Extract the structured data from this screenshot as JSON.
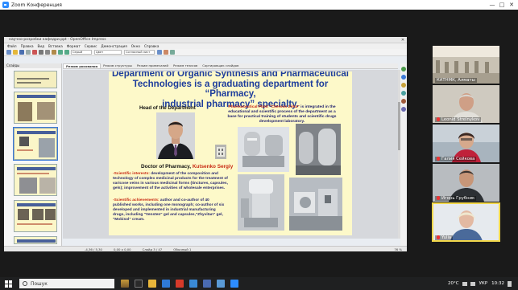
{
  "zoom": {
    "title": "Zoom Конференция",
    "minimize": "—",
    "maximize": "□",
    "close": "✕"
  },
  "impress": {
    "window_title": "научно-розробки кафедри.ppt - OpenOffice Impress",
    "close": "✕",
    "menu": [
      "Файл",
      "Правка",
      "Вид",
      "Вставка",
      "Формат",
      "Сервис",
      "Демонстрация",
      "Окно",
      "Справка"
    ],
    "toolbar": {
      "line_color": "Серый",
      "area": "Цвет",
      "line_value": "Согласный лист"
    },
    "slides_panel_title": "Слайды",
    "slide_numbers": [
      "",
      "",
      "",
      "",
      "",
      ""
    ],
    "tabs": [
      "Режим рисования",
      "Режим структуры",
      "Режим примечаний",
      "Режим тезисов",
      "Сортировщик слайдов"
    ],
    "status": [
      "-4,36 / 5,30",
      "0,00 x 0,00",
      "Слайд 3 / 47",
      "Обычный 1"
    ],
    "zoom_level": "76 %"
  },
  "slide": {
    "title_line1": "Department of Organic Synthesis and Pharmaceutical",
    "title_line2a": "Technologies",
    "title_line2b": " is a graduating department for “Pharmacy,",
    "title_line3": "industrial pharmacy” specialty.",
    "head_label": "Head of the Department",
    "doctor_prefix": "Doctor of Pharmacy, ",
    "doctor_name": "Kutsenko Sergiy",
    "plant_name": "Pharmaceutical Plant \"Chervon Zirka\"",
    "plant_text": " is integrated in the educational and scientific process of the department as a base for practical training of students and scientific drugs development laboratory.",
    "interests_label": "-Scientific interests:",
    "interests_text": " development of the composition and technology of complex medicinal products for the treatment of varicose veins in various medicinal forms (tinctures, capsules, gels); improvement of the activities of wholesale enterprises.",
    "achievements_label": "-Scientific achievements:",
    "achievements_text": " author and co-author of 40 published works, including one monograph; co-author of six developed and implemented in industrial manufacturing drugs, including \"Vensten\" gel and capsules,\"Zhyvitan\" gel, \"Mobisol\" cream."
  },
  "participants": [
    {
      "name": "КАТНМК, Алматы",
      "muted": false
    },
    {
      "name": "Leonid Strelnykov",
      "muted": true
    },
    {
      "name": "Галия Сейкова",
      "muted": true
    },
    {
      "name": "Игорь Грубник",
      "muted": true
    },
    {
      "name": "Yulia",
      "muted": true
    }
  ],
  "taskbar": {
    "search_placeholder": "Пошук",
    "temperature": "20°C",
    "language": "УКР",
    "clock": "10:32"
  },
  "colors": {
    "slide_bg": "#fdf9c9",
    "title_blue": "#1d3d9c",
    "accent_red": "#c82a13",
    "active_speaker": "#f2d84b",
    "zoom_blue": "#2d8cff"
  }
}
